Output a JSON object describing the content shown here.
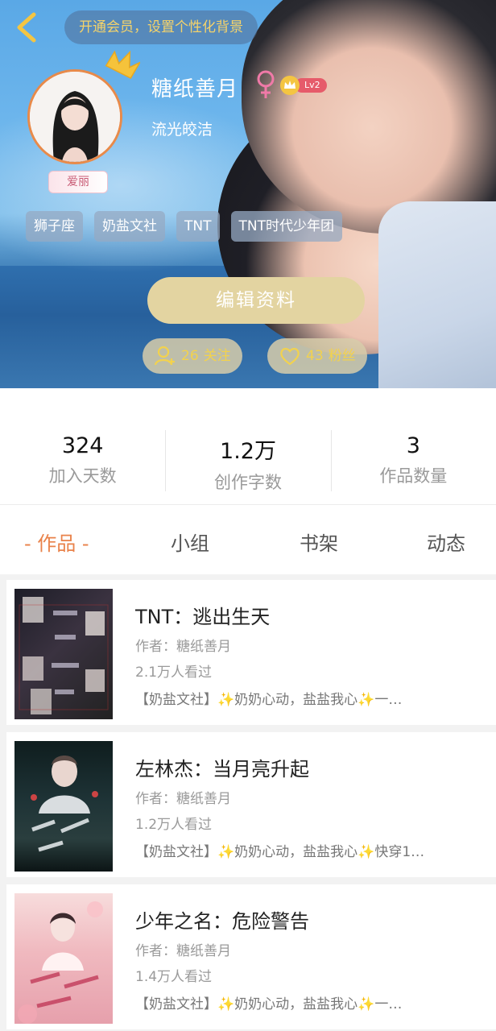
{
  "header": {
    "vip_banner": "开通会员，设置个性化背景",
    "username": "糖纸善月",
    "level": "Lv2",
    "bio": "流光皎洁",
    "avatar_tag": "爱丽",
    "tags": [
      "狮子座",
      "奶盐文社",
      "TNT",
      "TNT时代少年团"
    ],
    "edit_profile": "编辑资料",
    "follows_count": "26",
    "follows_label": "关注",
    "fans_count": "43",
    "fans_label": "粉丝"
  },
  "stats": [
    {
      "value": "324",
      "label": "加入天数"
    },
    {
      "value": "1.2万",
      "label": "创作字数"
    },
    {
      "value": "3",
      "label": "作品数量"
    }
  ],
  "tabs": [
    "- 作品 -",
    "小组",
    "书架",
    "动态"
  ],
  "works": [
    {
      "title": "TNT：逃出生天",
      "author": "作者：糖纸善月",
      "views": "2.1万人看过",
      "desc": "【奶盐文社】✨奶奶心动，盐盐我心✨一…"
    },
    {
      "title": "左林杰：当月亮升起",
      "author": "作者：糖纸善月",
      "views": "1.2万人看过",
      "desc": "【奶盐文社】✨奶奶心动，盐盐我心✨快穿1…"
    },
    {
      "title": "少年之名：危险警告",
      "author": "作者：糖纸善月",
      "views": "1.4万人看过",
      "desc": "【奶盐文社】✨奶奶心动，盐盐我心✨一…"
    }
  ],
  "colors": {
    "accent": "#e9824a",
    "edit_button": "#e3d4a1",
    "gold": "#f2d24e"
  }
}
